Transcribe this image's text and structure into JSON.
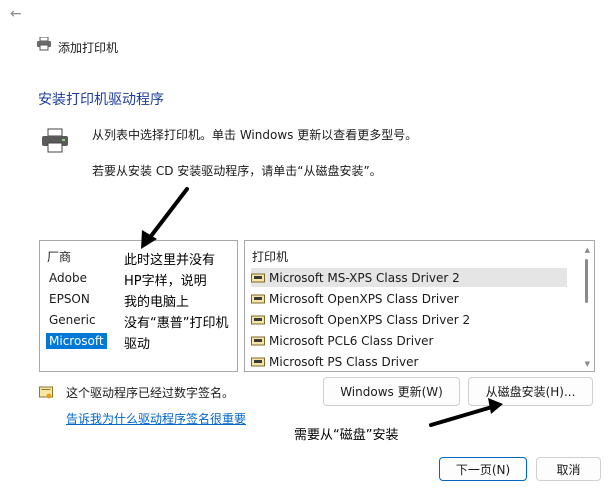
{
  "window": {
    "title": "添加打印机"
  },
  "heading": "安装打印机驱动程序",
  "description": {
    "line1": "从列表中选择打印机。单击 Windows 更新以查看更多型号。",
    "line2": "若要从安装 CD 安装驱动程序，请单击“从磁盘安装”。"
  },
  "manufacturer_list": {
    "header": "厂商",
    "items": [
      "Adobe",
      "EPSON",
      "Generic",
      "Microsoft"
    ],
    "selected": "Microsoft"
  },
  "printer_list": {
    "header": "打印机",
    "items": [
      "Microsoft MS-XPS Class Driver 2",
      "Microsoft OpenXPS Class Driver",
      "Microsoft OpenXPS Class Driver 2",
      "Microsoft PCL6 Class Driver",
      "Microsoft PS Class Driver"
    ],
    "selected": "Microsoft MS-XPS Class Driver 2"
  },
  "signature": {
    "text": "这个驱动程序已经过数字签名。",
    "link": "告诉我为什么驱动程序签名很重要"
  },
  "buttons": {
    "windows_update": "Windows 更新(W)",
    "have_disk": "从磁盘安装(H)...",
    "next": "下一页(N)",
    "cancel": "取消"
  },
  "annotations": {
    "note1": [
      "此时这里并没有",
      "HP字样，说明",
      "我的电脑上",
      "没有“惠普”打印机",
      "驱动"
    ],
    "note2": "需要从“磁盘”安装"
  },
  "colors": {
    "accent": "#0078d7",
    "heading": "#1c3c9c",
    "link": "#0066cc"
  },
  "icons": [
    "back-arrow-icon",
    "printer-icon",
    "certificate-icon"
  ]
}
